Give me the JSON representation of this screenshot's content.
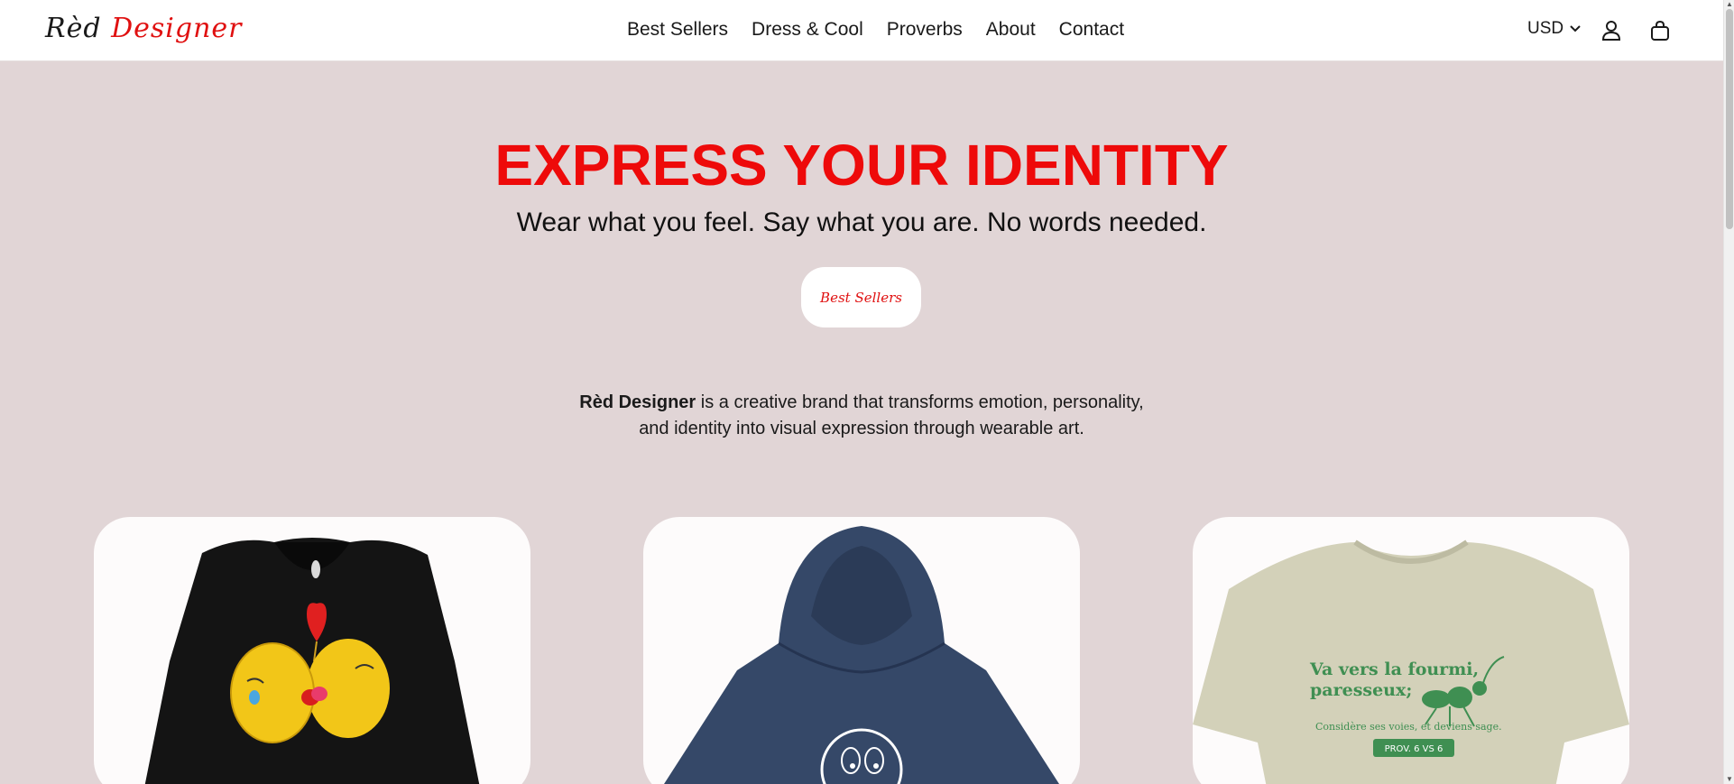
{
  "header": {
    "logo": {
      "part1": "Rèd ",
      "part2": "Designer"
    },
    "nav": [
      "Best Sellers",
      "Dress & Cool",
      "Proverbs",
      "About",
      "Contact"
    ],
    "currency": "USD",
    "icons": {
      "account": "user-icon",
      "cart": "bag-icon",
      "currency_caret": "chevron-down-icon"
    }
  },
  "hero": {
    "title": "EXPRESS YOUR IDENTITY",
    "subtitle": "Wear what you feel. Say what you are. No words needed.",
    "cta": "Best Sellers"
  },
  "about": {
    "brand": "Rèd Designer",
    "line1_rest": " is a creative brand that transforms emotion, personality,",
    "line2": "and identity into visual expression through wearable art."
  },
  "products": [
    {
      "name": "black-kiss-emoji-hoodie"
    },
    {
      "name": "navy-hoodie"
    },
    {
      "name": "proverbs-ant-tshirt",
      "print_line1": "Va vers la fourmi,",
      "print_line2": "paresseux;",
      "print_line3": "Considère ses voies, et deviens sage.",
      "print_badge": "PROV. 6 VS 6"
    }
  ],
  "colors": {
    "accent": "#ee0a0a",
    "background": "#e1d5d6",
    "card": "#fdfbfb",
    "ant_green": "#3f8f52"
  }
}
